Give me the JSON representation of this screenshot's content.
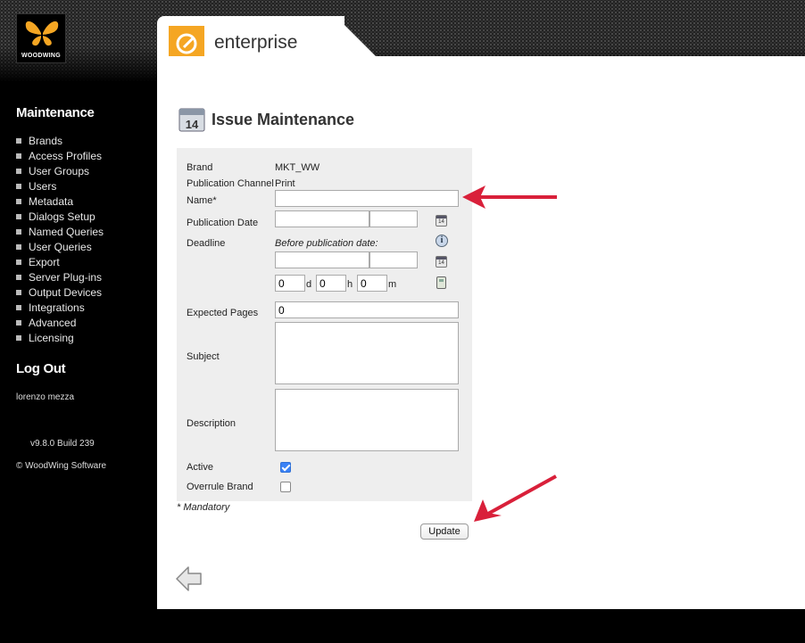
{
  "brand": {
    "logo_text": "WOODWING"
  },
  "app": {
    "tab_title": "enterprise"
  },
  "sidebar": {
    "title": "Maintenance",
    "items": [
      {
        "label": "Brands"
      },
      {
        "label": "Access Profiles"
      },
      {
        "label": "User Groups"
      },
      {
        "label": "Users"
      },
      {
        "label": "Metadata"
      },
      {
        "label": "Dialogs Setup"
      },
      {
        "label": "Named Queries"
      },
      {
        "label": "User Queries"
      },
      {
        "label": "Export"
      },
      {
        "label": "Server Plug-ins"
      },
      {
        "label": "Output Devices"
      },
      {
        "label": "Integrations"
      },
      {
        "label": "Advanced"
      },
      {
        "label": "Licensing"
      }
    ],
    "logout_label": "Log Out",
    "user_name": "lorenzo mezza",
    "version": "v9.8.0 Build 239",
    "copyright": "© WoodWing Software"
  },
  "page": {
    "title": "Issue Maintenance",
    "calendar_icon_number": "14"
  },
  "form": {
    "brand_label": "Brand",
    "brand_value": "MKT_WW",
    "channel_label": "Publication Channel",
    "channel_value": "Print",
    "name_label": "Name*",
    "name_value": "",
    "pubdate_label": "Publication Date",
    "pubdate_date": "",
    "pubdate_time": "",
    "deadline_label": "Deadline",
    "deadline_note": "Before publication date:",
    "deadline_date": "",
    "deadline_time": "",
    "days_value": "0",
    "days_unit": "d",
    "hours_value": "0",
    "hours_unit": "h",
    "minutes_value": "0",
    "minutes_unit": "m",
    "expected_pages_label": "Expected Pages",
    "expected_pages_value": "0",
    "subject_label": "Subject",
    "description_label": "Description",
    "active_label": "Active",
    "active_checked": true,
    "overrule_label": "Overrule Brand",
    "overrule_checked": false,
    "mandatory_note": "* Mandatory",
    "update_label": "Update"
  },
  "colors": {
    "accent": "#f5a623",
    "annotation_arrow": "#d9203a",
    "form_bg": "#eeeeee"
  }
}
